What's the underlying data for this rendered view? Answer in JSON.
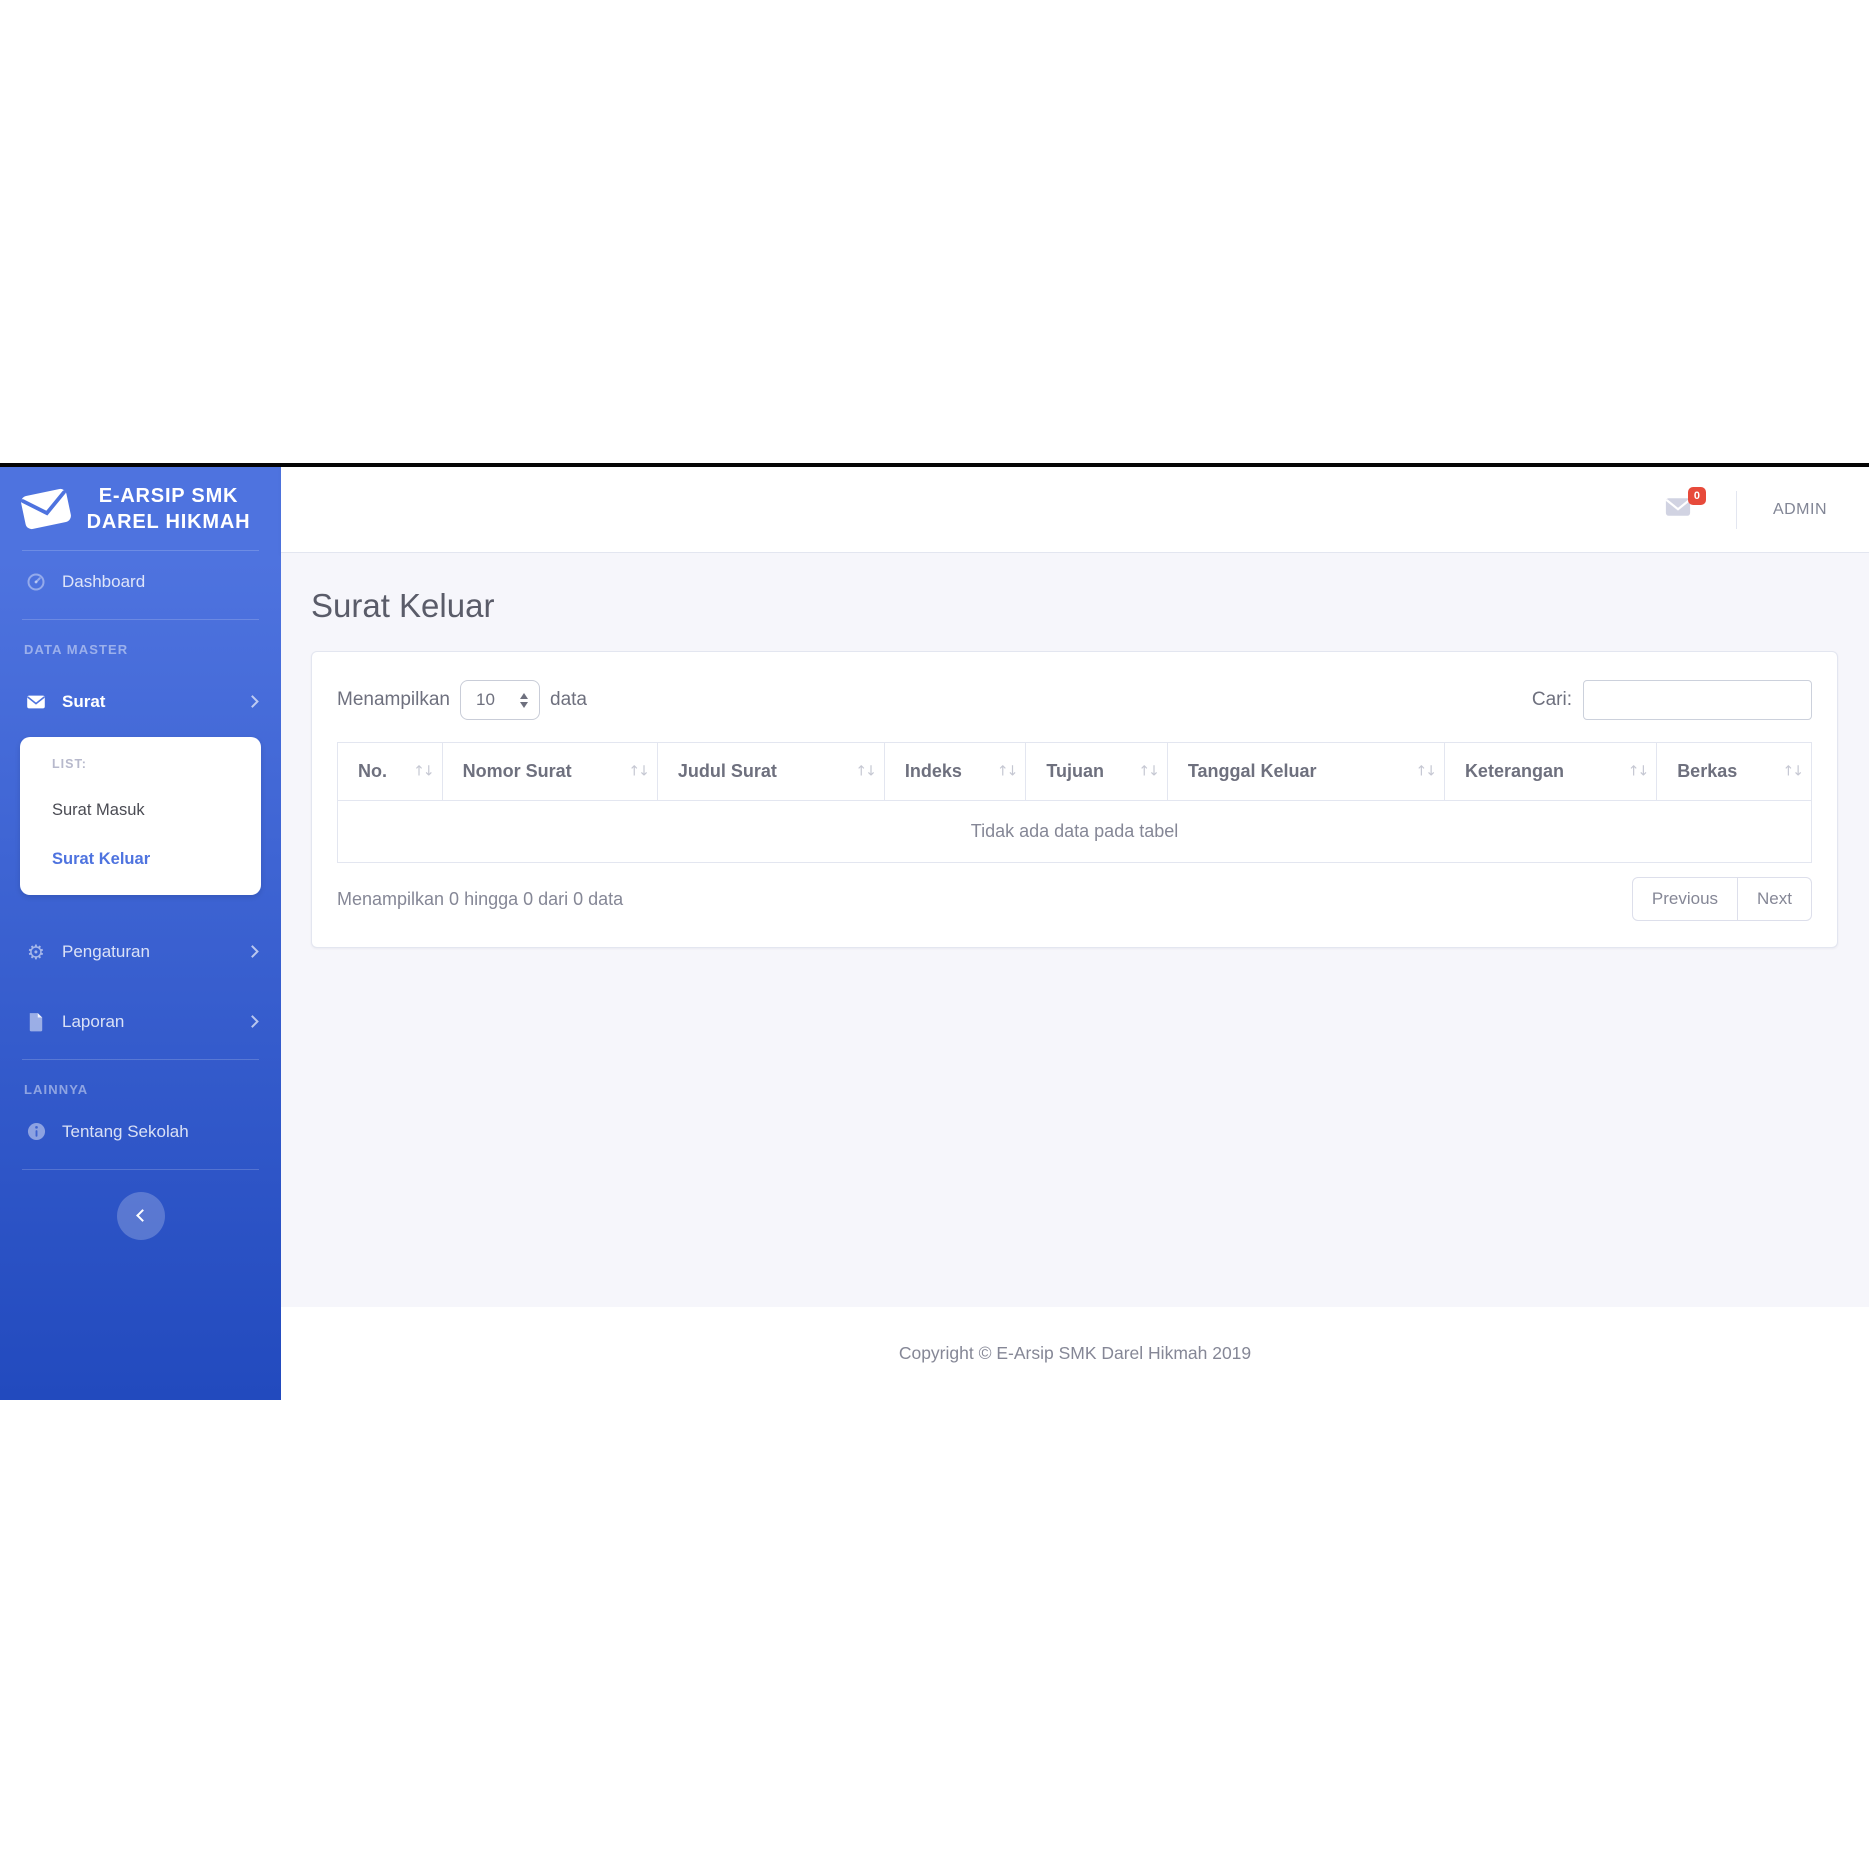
{
  "colors": {
    "sidebar_top": "#4e73df",
    "sidebar_bottom": "#224abe",
    "accent": "#4e73df",
    "danger_badge": "#e74a3b",
    "content_bg": "#f6f6fb",
    "border": "#e3e6f0"
  },
  "icons": {
    "sort": "↑↓",
    "gear": "⚙"
  },
  "sidebar": {
    "brand": "E-ARSIP SMK DAREL HIKMAH",
    "brand_icon": "envelope-icon",
    "sections": [
      {
        "label": "DATA MASTER"
      },
      {
        "label": "LAINNYA"
      }
    ],
    "items": [
      {
        "label": "Dashboard",
        "icon": "speedometer-icon"
      },
      {
        "label": "Surat",
        "icon": "envelope-icon"
      },
      {
        "label": "Pengaturan",
        "icon": "gear-icon"
      },
      {
        "label": "Laporan",
        "icon": "file-icon"
      },
      {
        "label": "Tentang Sekolah",
        "icon": "info-circle-icon"
      }
    ],
    "submenu": {
      "heading": "LIST:",
      "items": [
        {
          "label": "Surat Masuk",
          "active": false
        },
        {
          "label": "Surat Keluar",
          "active": true
        }
      ]
    }
  },
  "topbar": {
    "unread_count": "0",
    "user": "ADMIN"
  },
  "page": {
    "title": "Surat Keluar"
  },
  "table_card": {
    "length_label_before": "Menampilkan",
    "length_value": "10",
    "length_label_after": "data",
    "search_label": "Cari:",
    "columns": [
      "No.",
      "Nomor Surat",
      "Judul Surat",
      "Indeks",
      "Tujuan",
      "Tanggal Keluar",
      "Keterangan",
      "Berkas"
    ],
    "empty_text": "Tidak ada data pada tabel",
    "info": "Menampilkan 0 hingga 0 dari 0 data",
    "pagination": {
      "previous": "Previous",
      "next": "Next"
    }
  },
  "footer": {
    "copyright": "Copyright © E-Arsip SMK Darel Hikmah 2019"
  }
}
